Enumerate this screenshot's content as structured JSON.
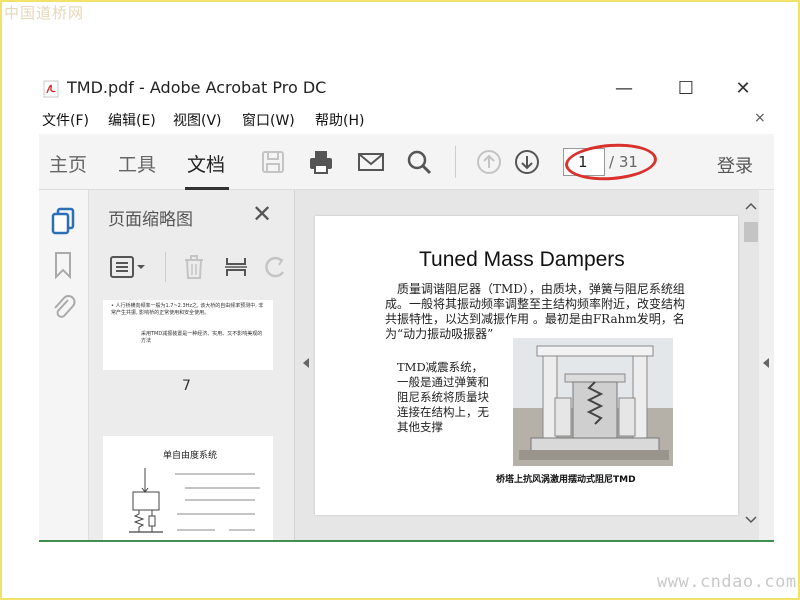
{
  "watermarks": {
    "top": "中国道桥网",
    "bottom": "www.cndao.com"
  },
  "window": {
    "title": "TMD.pdf - Adobe Acrobat Pro DC",
    "min_label": "—",
    "max_label": "☐",
    "close_label": "✕"
  },
  "menubar": {
    "items": [
      "文件(F)",
      "编辑(E)",
      "视图(V)",
      "窗口(W)",
      "帮助(H)"
    ],
    "close_label": "×"
  },
  "toolbar": {
    "tabs": [
      "主页",
      "工具",
      "文档"
    ],
    "active_tab": "文档",
    "current_page": "1",
    "total_pages": "/ 31",
    "login": "登录"
  },
  "thumbnail_panel": {
    "title": "页面缩略图",
    "close_label": "✕",
    "thumb1_lines": [
      "• 人行桥横向频率一般为1.7~2.3Hz之, 该大桥的自由频率预测中, 非常产生共振, 影响桥的正常使用和安全使用。",
      "采用TMD减振装置是一种经济、实用、又不影响美观的方法"
    ],
    "thumb1_page": "7",
    "thumb2_title": "单自由度系统"
  },
  "document": {
    "title": "Tuned Mass Dampers",
    "paragraph": "质量调谐阻尼器（TMD），由质块，弹簧与阻尼系统组成。一般将其振动频率调整至主结构频率附近，改变结构共振特性，以达到减振作用 。最初是由FRahm发明，名为“动力振动吸振器”",
    "left_text": "TMD减震系统，一般是通过弹簧和阻尼系统将质量块连接在结构上，无其他支撑",
    "caption": "桥塔上抗风涡激用摆动式阻尼TMD"
  },
  "colors": {
    "accent_blue": "#2d6fb5",
    "highlight_red": "#d9312b",
    "pdf_red": "#d4302a"
  }
}
